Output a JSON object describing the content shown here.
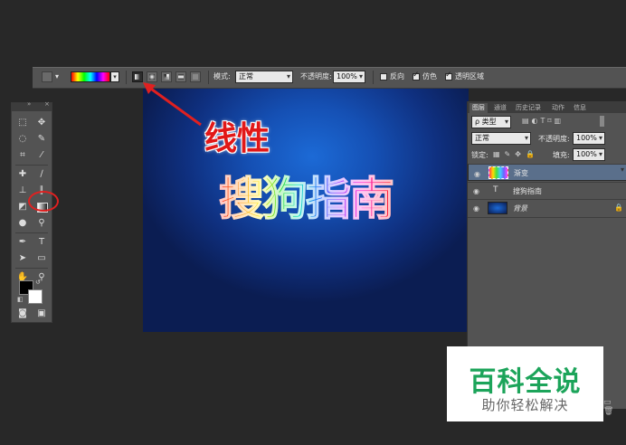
{
  "options_bar": {
    "mode_label": "模式:",
    "mode_value": "正常",
    "opacity_label": "不透明度:",
    "opacity_value": "100%",
    "reverse_label": "反向",
    "dither_label": "仿色",
    "transparency_label": "透明区域",
    "reverse_checked": false,
    "dither_checked": true,
    "transparency_checked": true,
    "gradient_types": [
      "linear",
      "radial",
      "angle",
      "reflected",
      "diamond"
    ],
    "selected_gradient_type": "linear"
  },
  "canvas": {
    "text": "搜狗指南"
  },
  "annotation": {
    "label": "线性",
    "color": "#e11818"
  },
  "layers_panel": {
    "tabs": [
      "图层",
      "通道",
      "历史记录",
      "动作",
      "信息"
    ],
    "active_tab": "图层",
    "filter_label": "ρ 类型",
    "blend_mode": "正常",
    "opacity_label": "不透明度:",
    "opacity_value": "100%",
    "lock_label": "锁定:",
    "fill_label": "填充:",
    "fill_value": "100%",
    "layers": [
      {
        "name": "渐变",
        "kind": "gradient",
        "selected": true
      },
      {
        "name": "搜狗指南",
        "kind": "text",
        "selected": false
      },
      {
        "name": "背景",
        "kind": "background",
        "selected": false,
        "locked": true
      }
    ]
  },
  "logo": {
    "title": "百科全说",
    "subtitle": "助你轻松解决",
    "color": "#1ca45a"
  }
}
